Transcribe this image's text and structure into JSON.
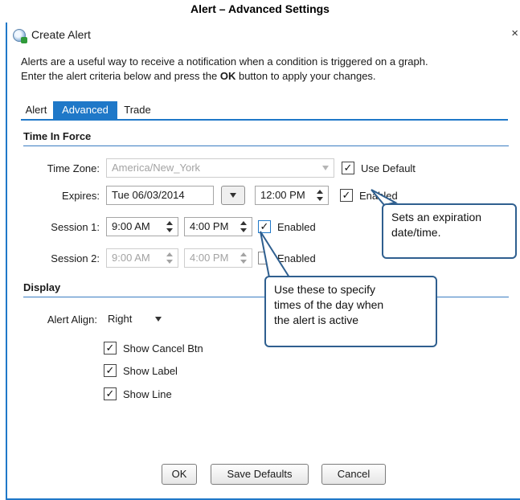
{
  "page_heading": "Alert – Advanced Settings",
  "window": {
    "title": "Create Alert",
    "close": "×"
  },
  "description": {
    "line1": "Alerts are a useful way to receive a notification when a condition is triggered on a graph.",
    "line2_before": "Enter the alert criteria below and press the ",
    "line2_bold": "OK",
    "line2_after": " button to apply your changes."
  },
  "tabs": [
    {
      "label": "Alert",
      "active": false
    },
    {
      "label": "Advanced",
      "active": true
    },
    {
      "label": "Trade",
      "active": false
    }
  ],
  "time_in_force": {
    "section_title": "Time In Force",
    "timezone_label": "Time Zone:",
    "timezone_value": "America/New_York",
    "use_default_label": "Use Default",
    "use_default_checked": true,
    "expires_label": "Expires:",
    "expires_date": "Tue 06/03/2014",
    "expires_time": "12:00 PM",
    "expires_enabled_label": "Enabled",
    "expires_enabled_checked": true,
    "session1_label": "Session 1:",
    "session1_start": "9:00 AM",
    "session1_end": "4:00 PM",
    "session1_enabled_label": "Enabled",
    "session1_enabled_checked": true,
    "session2_label": "Session 2:",
    "session2_start": "9:00 AM",
    "session2_end": "4:00 PM",
    "session2_enabled_label": "Enabled",
    "session2_enabled_checked": false
  },
  "display": {
    "section_title": "Display",
    "alert_align_label": "Alert Align:",
    "alert_align_value": "Right",
    "show_cancel_btn_label": "Show Cancel Btn",
    "show_label_label": "Show Label",
    "show_line_label": "Show Line",
    "show_cancel_btn_checked": true,
    "show_label_checked": true,
    "show_line_checked": true
  },
  "buttons": {
    "ok": "OK",
    "save_defaults": "Save Defaults",
    "cancel": "Cancel"
  },
  "callouts": {
    "expiration_line1": "Sets an expiration",
    "expiration_line2": "date/time.",
    "sessions_line1": "Use these to specify",
    "sessions_line2": "times of the day when",
    "sessions_line3": "the alert is active"
  },
  "colors": {
    "accent": "#1f78c8",
    "callout_border": "#2f5f8f",
    "disabled_text": "#a3a3a3"
  }
}
